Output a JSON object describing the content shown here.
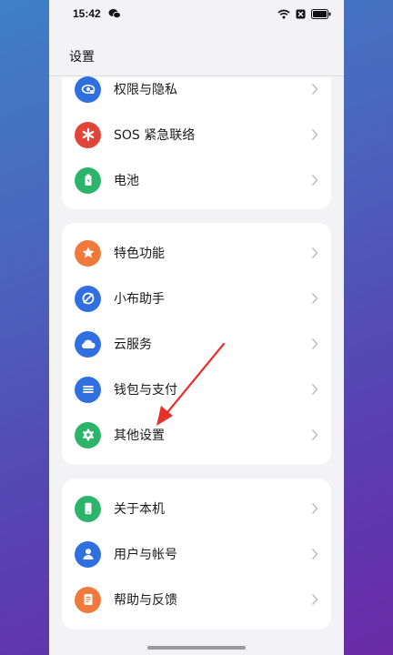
{
  "status_bar": {
    "time": "15:42"
  },
  "header": {
    "title": "设置"
  },
  "groups": [
    {
      "items": [
        {
          "label": "权限与隐私",
          "icon": "privacy-icon",
          "color": "#2f6fe0"
        },
        {
          "label": "SOS 紧急联络",
          "icon": "sos-icon",
          "color": "#e0453a"
        },
        {
          "label": "电池",
          "icon": "battery-icon",
          "color": "#2cb56a"
        }
      ]
    },
    {
      "items": [
        {
          "label": "特色功能",
          "icon": "star-icon",
          "color": "#f07a3c"
        },
        {
          "label": "小布助手",
          "icon": "assistant-icon",
          "color": "#2f6fe0"
        },
        {
          "label": "云服务",
          "icon": "cloud-icon",
          "color": "#2f6fe0"
        },
        {
          "label": "钱包与支付",
          "icon": "wallet-icon",
          "color": "#2f6fe0"
        },
        {
          "label": "其他设置",
          "icon": "gear-icon",
          "color": "#2cb56a"
        }
      ]
    },
    {
      "items": [
        {
          "label": "关于本机",
          "icon": "phone-icon",
          "color": "#2cb56a"
        },
        {
          "label": "用户与帐号",
          "icon": "user-icon",
          "color": "#2f6fe0"
        },
        {
          "label": "帮助与反馈",
          "icon": "help-icon",
          "color": "#f07a3c"
        }
      ]
    }
  ],
  "annotation": {
    "arrow_color": "#e8302a"
  }
}
